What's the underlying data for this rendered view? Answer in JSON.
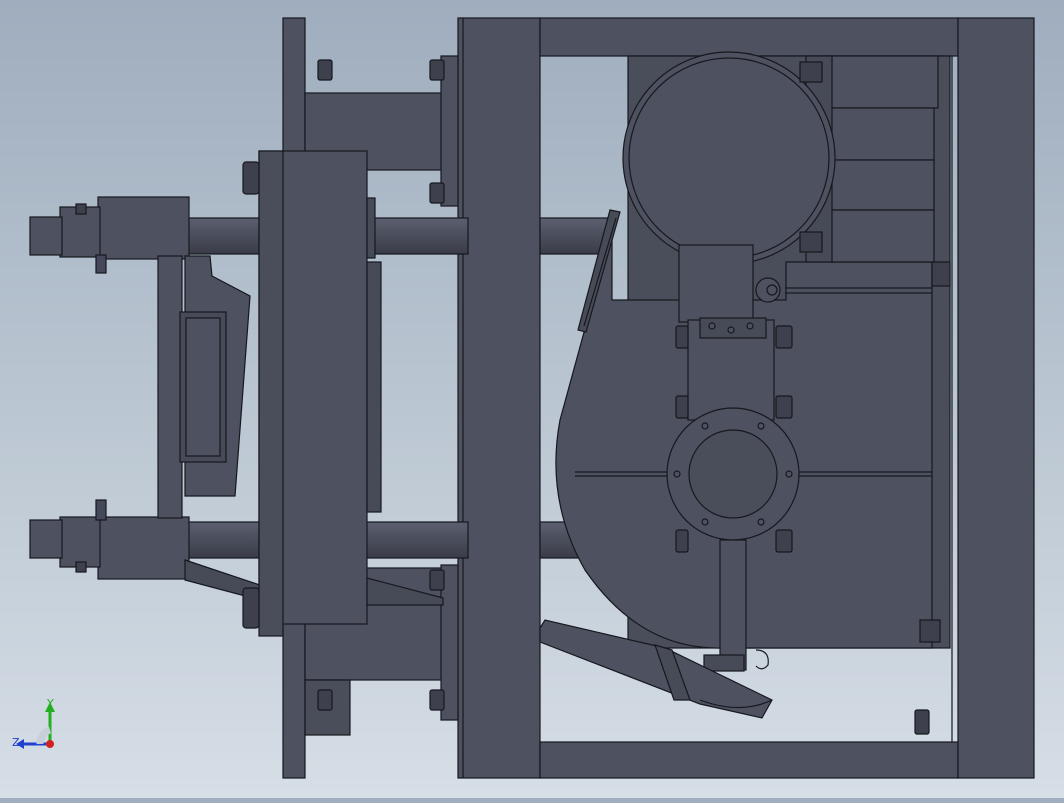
{
  "viewport": {
    "colors": {
      "background_top": "#9fadbe",
      "background_bottom": "#d6dee6",
      "body": "#4e5260",
      "body_dark": "#3e414d",
      "body_light": "#5a5f6d",
      "edge": "#16181e"
    }
  },
  "triad": {
    "y_label": "Y",
    "z_label": "Z",
    "x_color": "#d02020",
    "y_color": "#20b020",
    "z_color": "#2040d0"
  }
}
